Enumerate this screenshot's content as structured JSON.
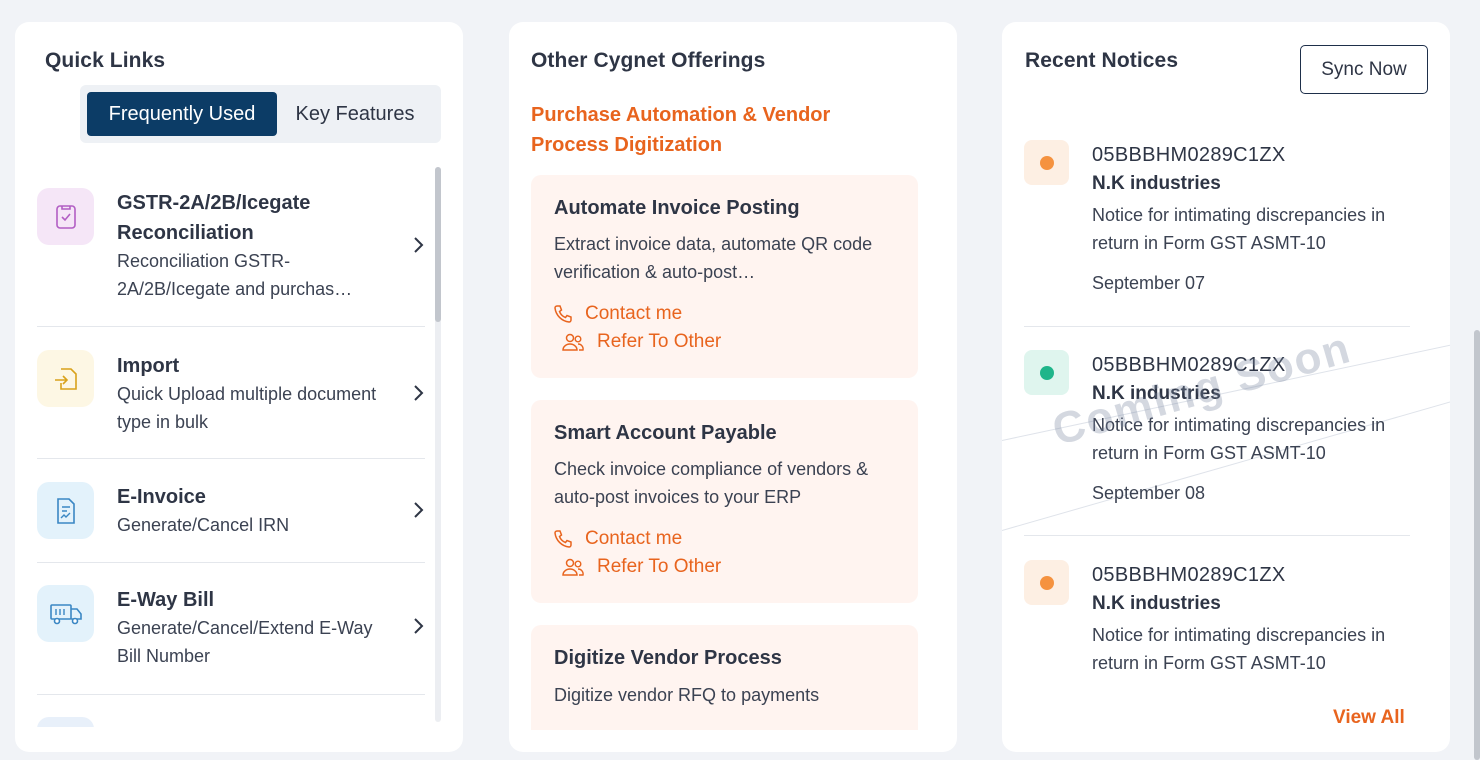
{
  "quick_links": {
    "title": "Quick Links",
    "tabs": {
      "active": "Frequently Used",
      "inactive": "Key Features"
    },
    "items": [
      {
        "title": "GSTR-2A/2B/Icegate Reconciliation",
        "desc": "Reconciliation GSTR-2A/2B/Icegate and purchas…",
        "icon": "document-check-icon",
        "icon_bg": "#f5e6f7",
        "icon_color": "#b25ec4"
      },
      {
        "title": "Import",
        "desc": "Quick Upload multiple document type in bulk",
        "icon": "import-icon",
        "icon_bg": "#fdf7e4",
        "icon_color": "#d9a21b"
      },
      {
        "title": "E-Invoice",
        "desc": "Generate/Cancel IRN",
        "icon": "invoice-icon",
        "icon_bg": "#e3f2fb",
        "icon_color": "#3a87c4"
      },
      {
        "title": "E-Way Bill",
        "desc": "Generate/Cancel/Extend E-Way Bill Number",
        "icon": "truck-icon",
        "icon_bg": "#e3f2fb",
        "icon_color": "#3a87c4"
      }
    ]
  },
  "offerings": {
    "title": "Other Cygnet Offerings",
    "section": "Purchase Automation & Vendor Process Digitization",
    "cards": [
      {
        "title": "Automate Invoice Posting",
        "desc": "Extract invoice data, automate QR code verification & auto-post…",
        "contact": "Contact me",
        "refer": "Refer To Other"
      },
      {
        "title": "Smart Account Payable",
        "desc": "Check invoice compliance of vendors & auto-post invoices to your ERP",
        "contact": "Contact me",
        "refer": "Refer To Other"
      },
      {
        "title": "Digitize Vendor Process",
        "desc": "Digitize vendor RFQ to payments"
      }
    ]
  },
  "notices": {
    "title": "Recent Notices",
    "sync_label": "Sync Now",
    "watermark": "Coming Soon",
    "view_all": "View All",
    "items": [
      {
        "gstin": "05BBBHM0289C1ZX",
        "company": "N.K industries",
        "text": "Notice for intimating discrepancies in return in Form GST ASMT-10",
        "date": "September 07",
        "dot_color": "#f5923f",
        "dot_bg": "#fdefe3"
      },
      {
        "gstin": "05BBBHM0289C1ZX",
        "company": "N.K industries",
        "text": "Notice for intimating discrepancies in return in Form GST ASMT-10",
        "date": "September 08",
        "dot_color": "#1fb58a",
        "dot_bg": "#dff5ee"
      },
      {
        "gstin": "05BBBHM0289C1ZX",
        "company": "N.K industries",
        "text": "Notice for intimating discrepancies in return in Form GST ASMT-10",
        "date": "",
        "dot_color": "#f5923f",
        "dot_bg": "#fdefe3"
      }
    ]
  },
  "colors": {
    "accent": "#e8641e",
    "primary": "#0c3c66"
  }
}
